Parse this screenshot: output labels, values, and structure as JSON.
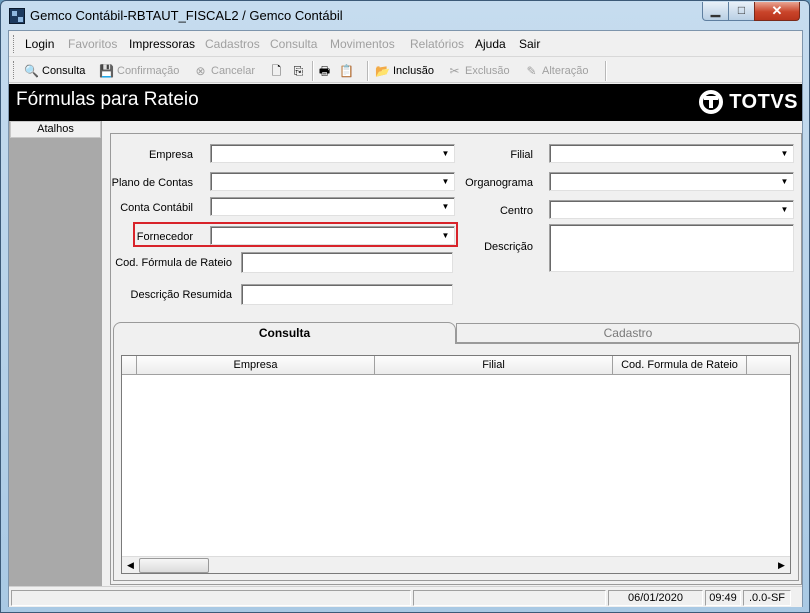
{
  "window": {
    "title": "Gemco Contábil-RBTAUT_FISCAL2 / Gemco Contábil",
    "minimize_glyph": "▁",
    "maximize_glyph": "□",
    "close_glyph": "✕"
  },
  "menu": [
    {
      "label": "Login",
      "enabled": true
    },
    {
      "label": "Favoritos",
      "enabled": false
    },
    {
      "label": "Impressoras",
      "enabled": true
    },
    {
      "label": "Cadastros",
      "enabled": false
    },
    {
      "label": "Consulta",
      "enabled": false
    },
    {
      "label": "Movimentos",
      "enabled": false
    },
    {
      "label": "Relatórios",
      "enabled": false
    },
    {
      "label": "Ajuda",
      "enabled": true
    },
    {
      "label": "Sair",
      "enabled": true
    }
  ],
  "toolbar": {
    "consulta": "Consulta",
    "confirmacao": "Confirmação",
    "cancelar": "Cancelar",
    "inclusao": "Inclusão",
    "exclusao": "Exclusão",
    "alteracao": "Alteração",
    "icons": [
      "search-icon",
      "save-icon",
      "cancel-icon",
      "new-document-icon",
      "export-icon",
      "print-icon",
      "report-icon",
      "include-icon",
      "delete-icon",
      "edit-icon"
    ]
  },
  "header": {
    "title": "Fórmulas para Rateio",
    "logo_text": "TOTVS"
  },
  "sidebar": {
    "atalhos": "Atalhos"
  },
  "form": {
    "empresa": {
      "label": "Empresa",
      "value": ""
    },
    "plano_contas": {
      "label": "Plano de Contas",
      "value": ""
    },
    "conta_contabil": {
      "label": "Conta Contábil",
      "value": ""
    },
    "fornecedor": {
      "label": "Fornecedor",
      "value": ""
    },
    "cod_formula": {
      "label": "Cod. Fórmula de Rateio",
      "value": ""
    },
    "descricao_resumida": {
      "label": "Descrição Resumida",
      "value": ""
    },
    "filial": {
      "label": "Filial",
      "value": ""
    },
    "organograma": {
      "label": "Organograma",
      "value": ""
    },
    "centro": {
      "label": "Centro",
      "value": ""
    },
    "descricao": {
      "label": "Descrição",
      "value": ""
    }
  },
  "tabs": [
    {
      "label": "Consulta",
      "active": true
    },
    {
      "label": "Cadastro",
      "active": false
    }
  ],
  "grid": {
    "columns": [
      "Empresa",
      "Filial",
      "Cod. Formula de Rateio"
    ],
    "rows": []
  },
  "status": {
    "date": "06/01/2020",
    "time": "09:49",
    "version": ".0.0-SF"
  },
  "colors": {
    "header_bg": "#000000",
    "highlight_border": "#d8232a",
    "sidebar_bg": "#a9a9a9"
  }
}
